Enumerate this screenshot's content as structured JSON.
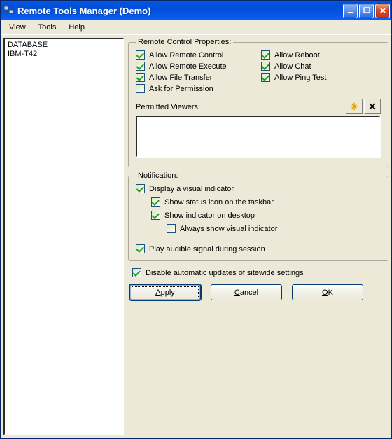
{
  "window": {
    "title": "Remote Tools Manager (Demo)"
  },
  "menubar": {
    "items": [
      "View",
      "Tools",
      "Help"
    ]
  },
  "sidebar": {
    "items": [
      "DATABASE",
      "IBM-T42"
    ]
  },
  "group_remote": {
    "legend": "Remote Control Properties:",
    "chk_allow_remote_control": {
      "label": "Allow Remote Control",
      "checked": true
    },
    "chk_allow_reboot": {
      "label": "Allow Reboot",
      "checked": true
    },
    "chk_allow_remote_execute": {
      "label": "Allow Remote Execute",
      "checked": true
    },
    "chk_allow_chat": {
      "label": "Allow Chat",
      "checked": true
    },
    "chk_allow_file_transfer": {
      "label": "Allow File Transfer",
      "checked": true
    },
    "chk_allow_ping_test": {
      "label": "Allow Ping Test",
      "checked": true
    },
    "chk_ask_permission": {
      "label": "Ask for Permission",
      "checked": false
    },
    "permitted_viewers_label": "Permitted Viewers:",
    "permitted_viewers_value": "",
    "icon_add": "add-sparkle-icon",
    "icon_remove": "delete-x-icon"
  },
  "group_notify": {
    "legend": "Notification:",
    "chk_visual_indicator": {
      "label": "Display a visual indicator",
      "checked": true
    },
    "chk_taskbar_icon": {
      "label": "Show status icon on the taskbar",
      "checked": true
    },
    "chk_indicator_desktop": {
      "label": "Show indicator on desktop",
      "checked": true
    },
    "chk_always_show": {
      "label": "Always show visual indicator",
      "checked": false
    },
    "chk_audible": {
      "label": "Play audible signal during session",
      "checked": true
    }
  },
  "chk_disable_updates": {
    "label": "Disable automatic updates of sitewide settings",
    "checked": true
  },
  "buttons": {
    "apply": "Apply",
    "cancel": "Cancel",
    "ok": "OK"
  }
}
